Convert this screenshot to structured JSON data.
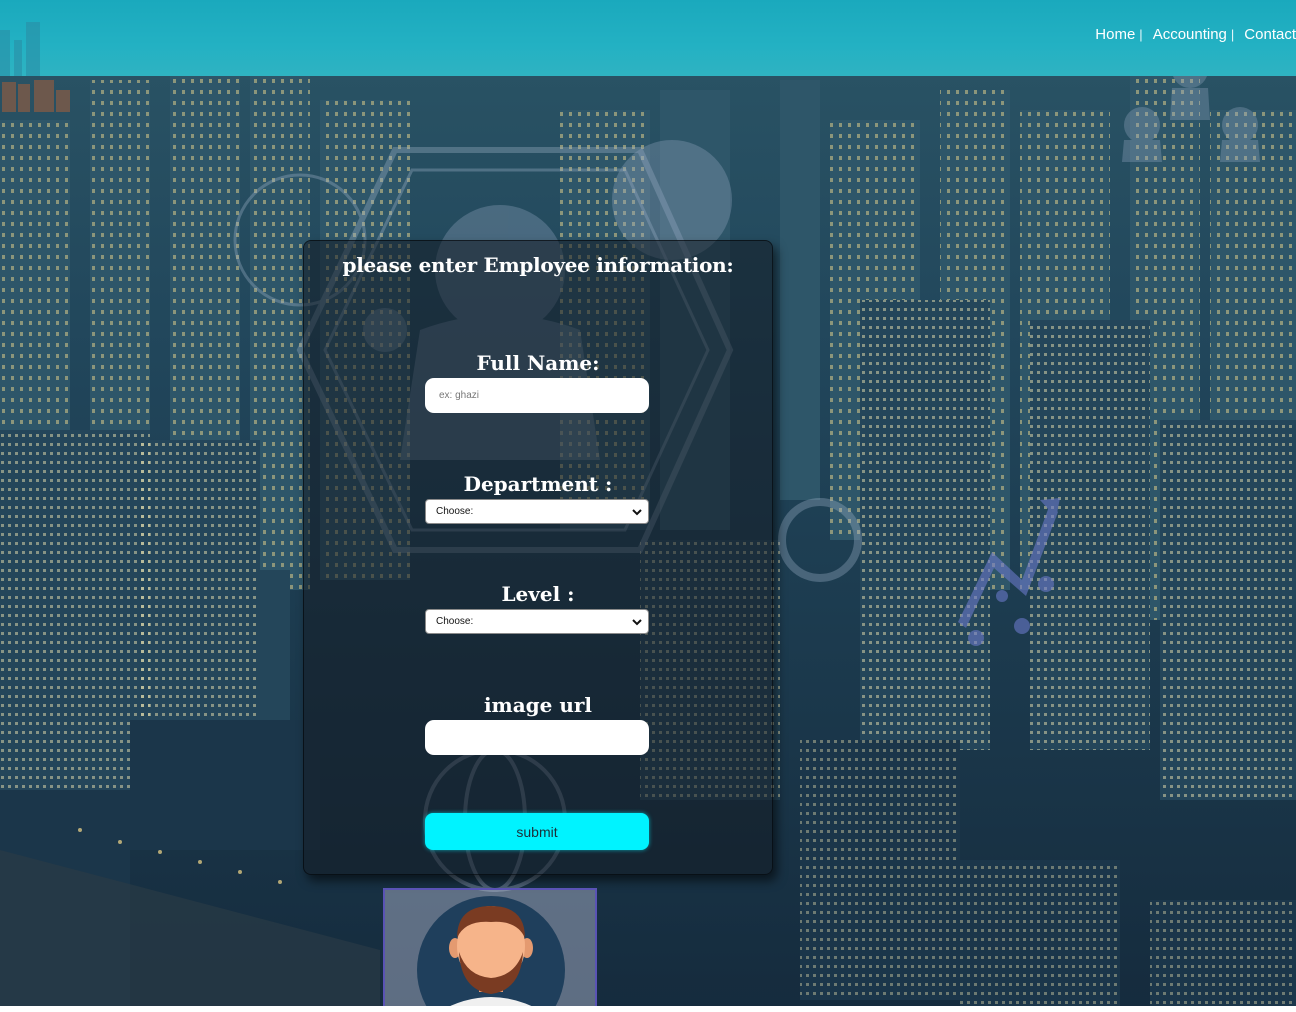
{
  "nav": {
    "items": [
      {
        "label": "Home",
        "sep": "|"
      },
      {
        "label": "Accounting",
        "sep": "|"
      },
      {
        "label": "Contact",
        "sep": ""
      }
    ]
  },
  "form": {
    "title": "please enter Employee information:",
    "full_name": {
      "label": "Full Name:",
      "placeholder": "ex: ghazi",
      "value": ""
    },
    "department": {
      "label": "Department :",
      "selected": "Choose:"
    },
    "level": {
      "label": "Level :",
      "selected": "Choose:"
    },
    "image_url": {
      "label": "image url",
      "value": ""
    },
    "submit_label": "submit"
  },
  "colors": {
    "header": "#1fadc0",
    "submit": "#00f3ff",
    "card": "rgba(20,28,36,0.55)",
    "avatar_border": "#5a53b5"
  }
}
